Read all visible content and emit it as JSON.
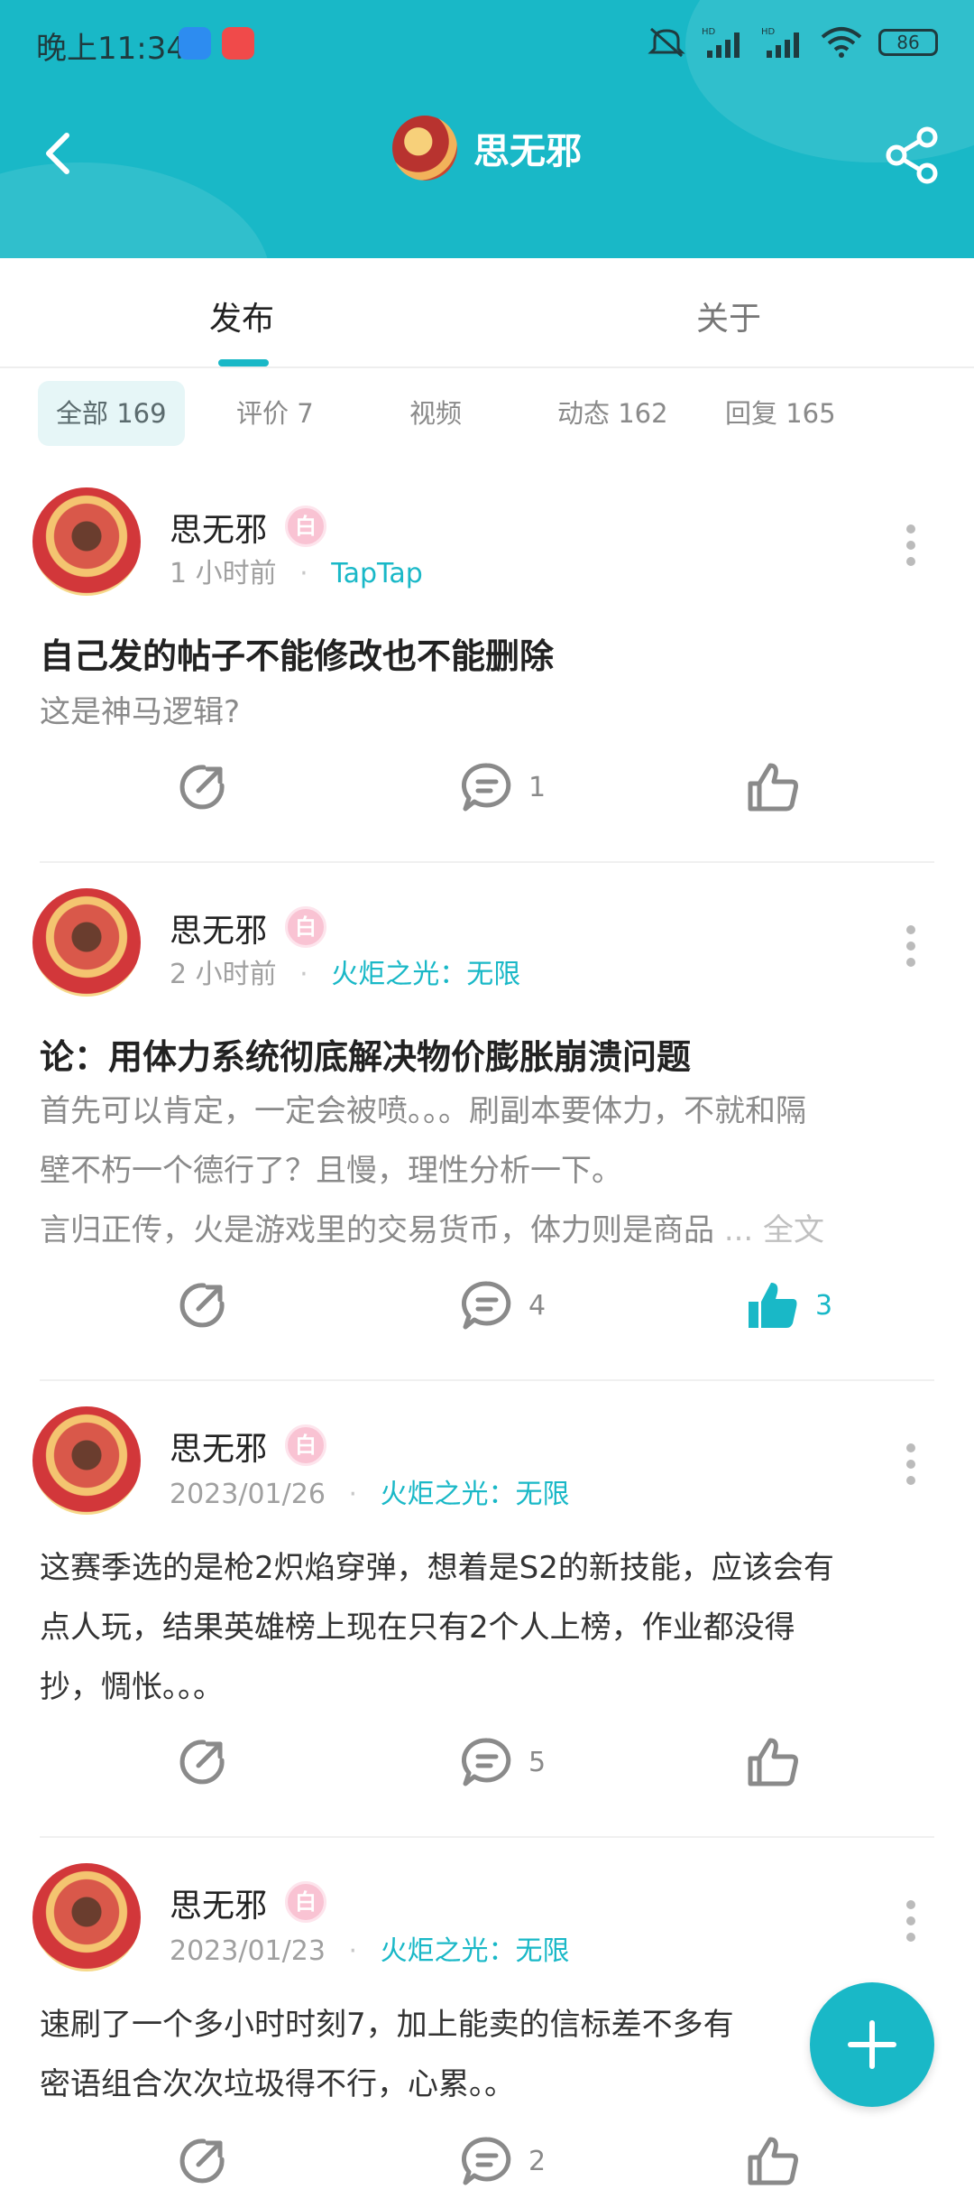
{
  "status_bar": {
    "time": "晚上11:34",
    "battery": "86"
  },
  "header": {
    "title": "思无邪"
  },
  "tabs": [
    {
      "label": "发布"
    },
    {
      "label": "关于"
    }
  ],
  "filters": [
    {
      "label": "全部 169"
    },
    {
      "label": "评价 7"
    },
    {
      "label": "视频"
    },
    {
      "label": "动态 162"
    },
    {
      "label": "回复 165"
    }
  ],
  "posts": [
    {
      "author": "思无邪",
      "badge": "白",
      "time": "1 小时前",
      "source": "TapTap",
      "title": "自己发的帖子不能修改也不能删除",
      "body": "这是神马逻辑?",
      "comments": "1",
      "likes": ""
    },
    {
      "author": "思无邪",
      "badge": "白",
      "time": "2 小时前",
      "source": "火炬之光：无限",
      "title": "论：用体力系统彻底解决物价膨胀崩溃问题",
      "body_lines": [
        "首先可以肯定，一定会被喷。。。刷副本要体力，不就和隔",
        "壁不朽一个德行了？且慢，理性分析一下。",
        "言归正传，火是游戏里的交易货币，体力则是商品"
      ],
      "full_text": "... 全文",
      "comments": "4",
      "likes": "3"
    },
    {
      "author": "思无邪",
      "badge": "白",
      "time": "2023/01/26",
      "source": "火炬之光：无限",
      "body_lines": [
        "这赛季选的是枪2炽焰穿弹，想着是S2的新技能，应该会有",
        "点人玩，结果英雄榜上现在只有2个人上榜，作业都没得",
        "抄，惆怅。。。"
      ],
      "comments": "5",
      "likes": ""
    },
    {
      "author": "思无邪",
      "badge": "白",
      "time": "2023/01/23",
      "source": "火炬之光：无限",
      "body_lines": [
        "速刷了一个多小时时刻7，加上能卖的信标差不多有",
        "密语组合次次垃圾得不行，心累。。"
      ],
      "comments": "2",
      "likes": ""
    }
  ],
  "colors": {
    "accent": "#19b8c7",
    "header_bg": "#19b8c7"
  }
}
